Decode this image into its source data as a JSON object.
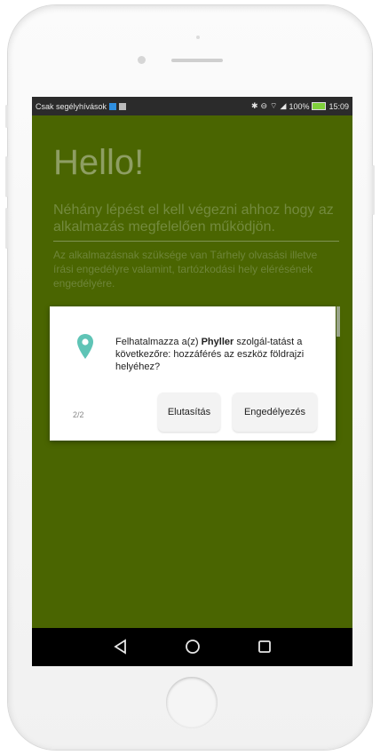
{
  "statusbar": {
    "carrier": "Csak segélyhívások",
    "battery": "100%",
    "time": "15:09"
  },
  "app": {
    "hello": "Hello!",
    "subtitle": "Néhány lépést el kell végezni ahhoz hogy az alkalmazás megfelelően működjön.",
    "description": "Az alkalmazásnak szüksége van Tárhely olvasási illetve írási engedélyre valamint, tartózkodási hely elérésének engedélyére."
  },
  "dialog": {
    "message_prefix": "Felhatalmazza a(z) ",
    "app_name": "Phyller",
    "message_suffix": " szolgál-tatást a következőre: hozzáférés az eszköz földrajzi helyéhez?",
    "counter": "2/2",
    "deny_label": "Elutasítás",
    "allow_label": "Engedélyezés"
  },
  "colors": {
    "screen_bg": "#4a6501",
    "pin": "#5fc4b6"
  },
  "icons": {
    "pin": "location-pin-icon",
    "back": "back-triangle-icon",
    "home": "home-circle-icon",
    "recents": "recents-square-icon"
  }
}
